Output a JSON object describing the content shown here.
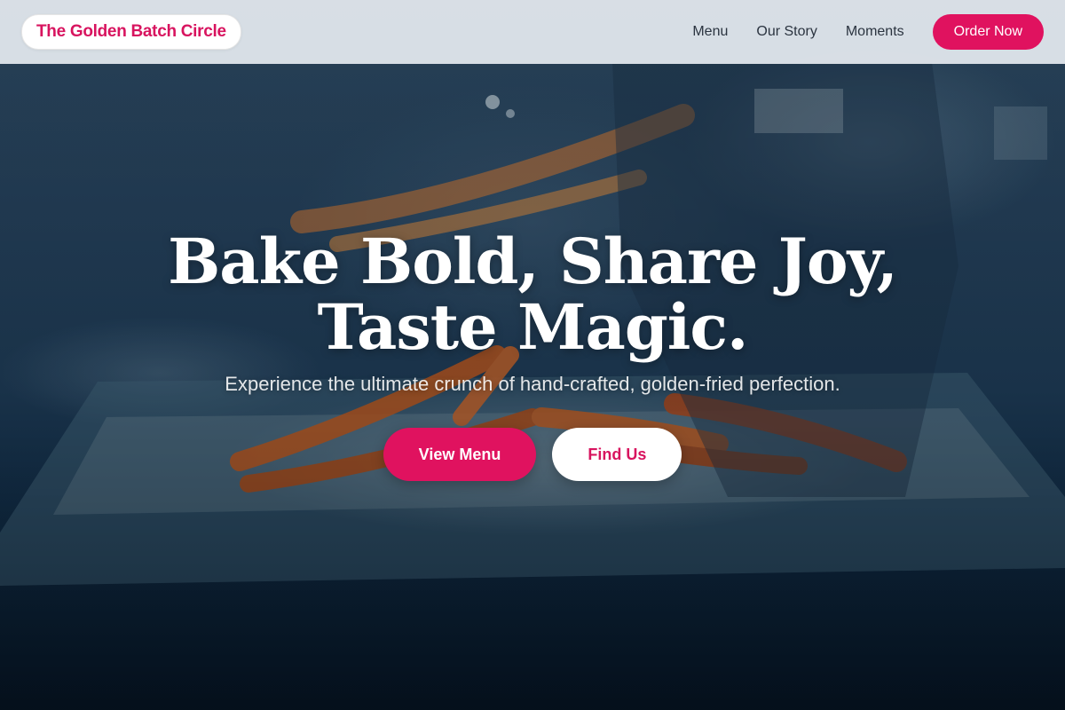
{
  "header": {
    "brand": "The Golden Batch Circle",
    "nav": [
      "Menu",
      "Our Story",
      "Moments"
    ],
    "cta": "Order Now"
  },
  "hero": {
    "title_line1": "Bake Bold, Share Joy,",
    "title_line2": "Taste Magic.",
    "subtitle": "Experience the ultimate crunch of hand-crafted, golden-fried perfection.",
    "primary_button": "View Menu",
    "secondary_button": "Find Us"
  },
  "colors": {
    "accent": "#e0125f",
    "brand_text": "#d8145f",
    "header_bg": "#ebf0f5"
  }
}
